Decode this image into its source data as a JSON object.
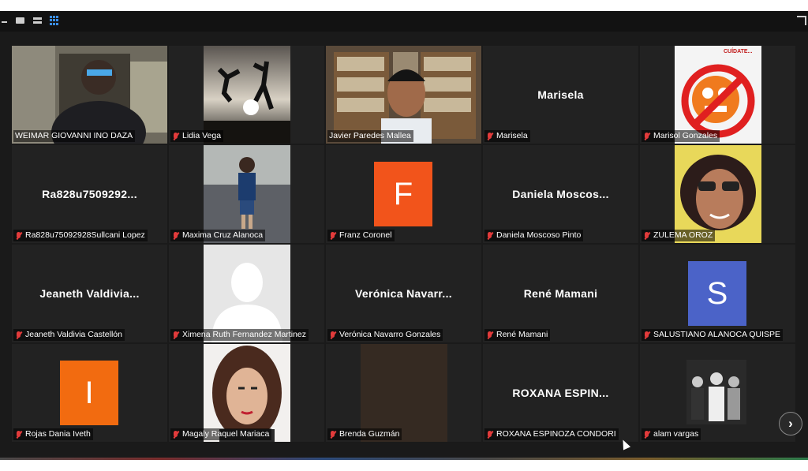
{
  "toolbar": {
    "minimize_icon": "minimize-icon",
    "speaker_view_icon": "speaker-view-icon",
    "list_view_icon": "list-view-icon",
    "gallery_view_icon": "gallery-view-icon",
    "fullscreen_icon": "fullscreen-icon"
  },
  "participants": [
    {
      "label": "WEIMAR GIOVANNI INO DAZA",
      "center": "",
      "muted": false,
      "video": "person-dark"
    },
    {
      "label": "Lidia Vega",
      "center": "",
      "muted": true,
      "video": "sunset"
    },
    {
      "label": "Javier Paredes Mallea",
      "center": "",
      "muted": false,
      "video": "library",
      "active": true
    },
    {
      "label": "Marisela",
      "center": "Marisela",
      "muted": true,
      "video": ""
    },
    {
      "label": "Marisol Gonzales",
      "center": "",
      "muted": true,
      "video": "cartoon",
      "photo_text": "CUÍDATE..."
    },
    {
      "label": "Ra828u75092928Sullcani Lopez",
      "center": "Ra828u7509292...",
      "muted": true,
      "video": ""
    },
    {
      "label": "Maxima Cruz Alanoca",
      "center": "",
      "muted": true,
      "video": "street"
    },
    {
      "label": "Franz Coronel",
      "center": "",
      "muted": true,
      "video": "",
      "avatar": "F",
      "avatar_color": "#f2541b"
    },
    {
      "label": "Daniela Moscoso Pinto",
      "center": "Daniela  Moscos...",
      "muted": true,
      "video": ""
    },
    {
      "label": "ZULEMA OROZ",
      "center": "",
      "muted": true,
      "video": "woman-sunglasses"
    },
    {
      "label": "Jeaneth Valdivia Castellón",
      "center": "Jeaneth  Valdivia...",
      "muted": true,
      "video": ""
    },
    {
      "label": "Ximena Ruth Fernandez Martinez",
      "center": "",
      "muted": true,
      "video": "silhouette"
    },
    {
      "label": "Verónica Navarro Gonzales",
      "center": "Verónica  Navarr...",
      "muted": true,
      "video": ""
    },
    {
      "label": "René Mamani",
      "center": "René Mamani",
      "muted": true,
      "video": ""
    },
    {
      "label": "SALUSTIANO ALANOCA QUISPE",
      "center": "",
      "muted": true,
      "video": "",
      "avatar": "S",
      "avatar_color": "#4b63c8"
    },
    {
      "label": "Rojas Dania Iveth",
      "center": "",
      "muted": true,
      "video": "",
      "avatar": "I",
      "avatar_color": "#f26b10"
    },
    {
      "label": "Magaly Raquel Mariaca",
      "center": "",
      "muted": true,
      "video": "portrait"
    },
    {
      "label": "Brenda Guzmán",
      "center": "",
      "muted": true,
      "video": "dim"
    },
    {
      "label": "ROXANA ESPINOZA CONDORI",
      "center": "ROXANA  ESPIN...",
      "muted": true,
      "video": ""
    },
    {
      "label": "alam vargas",
      "center": "",
      "muted": true,
      "video": "group-bw"
    }
  ],
  "next_page_icon": "chevron-right-icon"
}
